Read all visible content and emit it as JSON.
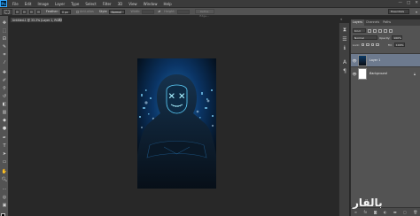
{
  "menubar": {
    "logo": "Ps",
    "items": [
      "File",
      "Edit",
      "Image",
      "Layer",
      "Type",
      "Select",
      "Filter",
      "3D",
      "View",
      "Window",
      "Help"
    ],
    "window_controls": [
      "—",
      "□",
      "✕"
    ]
  },
  "options_bar": {
    "feather_label": "Feather:",
    "feather_value": "0 px",
    "antialias_label": "Anti-alias",
    "style_label": "Style:",
    "style_value": "Normal",
    "width_label": "Width:",
    "height_label": "Height:",
    "refine_edge": "Refine Edge...",
    "workspace": "Essentials"
  },
  "document": {
    "tab_title": "Untitled-1 @ 33.3% (Layer 1, RGB/8) *"
  },
  "layers_panel": {
    "tabs": [
      "Layers",
      "Channels",
      "Paths"
    ],
    "kind_label": "Kind",
    "blend_mode": "Normal",
    "opacity_label": "Opacity:",
    "opacity_value": "100%",
    "lock_label": "Lock:",
    "fill_label": "Fill:",
    "fill_value": "100%",
    "layers": [
      {
        "name": "Layer 1",
        "selected": true
      },
      {
        "name": "Background",
        "selected": false
      }
    ],
    "footer_icons": [
      "link-icon",
      "fx-icon",
      "mask-icon",
      "adjustment-icon",
      "group-icon",
      "new-layer-icon",
      "trash-icon"
    ]
  },
  "watermark": "بالقار",
  "colors": {
    "menubar": "#3b3b3b",
    "panel": "#535353",
    "workspace_bg": "#282828",
    "selected_layer": "#6d7a8e",
    "accent_glow": "#4fd0ff"
  }
}
